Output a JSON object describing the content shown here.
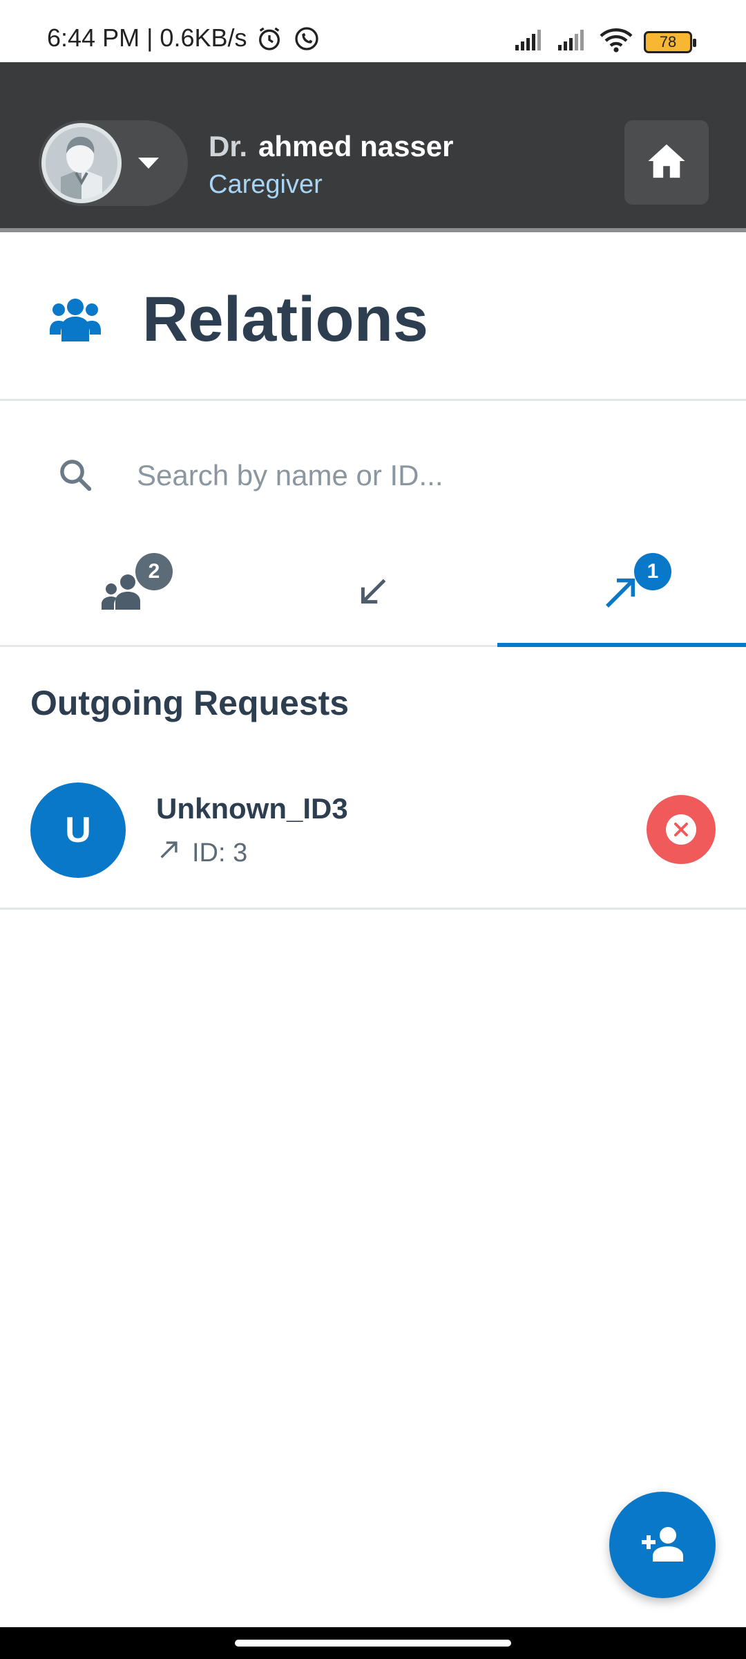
{
  "status_bar": {
    "time": "6:44 PM | 0.6KB/s",
    "battery_level": "78",
    "icons": [
      "alarm-icon",
      "whatsapp-icon",
      "signal-icon",
      "signal-icon",
      "wifi-icon",
      "battery-icon"
    ]
  },
  "header": {
    "title_prefix": "Dr.",
    "user_name": "ahmed nasser",
    "role": "Caregiver",
    "avatar_icon": "doctor-avatar-icon",
    "home_icon": "home-icon"
  },
  "page": {
    "title": "Relations",
    "title_icon": "users-group-icon"
  },
  "search": {
    "placeholder": "Search by name or ID...",
    "value": ""
  },
  "tabs": [
    {
      "icon": "users-icon",
      "badge": "2",
      "active": false
    },
    {
      "icon": "incoming-arrow-icon",
      "badge": "",
      "active": false
    },
    {
      "icon": "outgoing-arrow-icon",
      "badge": "1",
      "active": true
    }
  ],
  "section": {
    "title": "Outgoing Requests"
  },
  "requests": [
    {
      "initial": "U",
      "name": "Unknown_ID3",
      "id_label": "ID: 3"
    }
  ],
  "colors": {
    "header_bg": "#3a3b3d",
    "accent": "#0a78c8",
    "danger": "#f15a5a",
    "text_primary": "#2c3e50",
    "badge_gray": "#5c6b78"
  }
}
